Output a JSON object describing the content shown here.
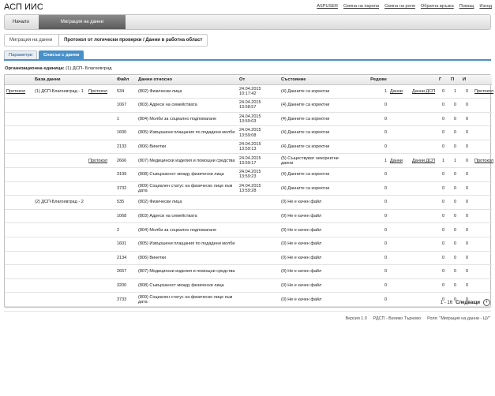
{
  "app": {
    "title": "АСП ИИС"
  },
  "top_links": [
    "ASPUSER",
    "Смяна на парола",
    "Смяна на роля",
    "Обратна връзка",
    "Помощ",
    "Изход"
  ],
  "nav": {
    "tabs": [
      {
        "label": "Начало"
      },
      {
        "label": "Миграция на данни",
        "active": true
      }
    ]
  },
  "breadcrumb": {
    "items": [
      "Миграция на данни",
      "Протокол от логически проверки / Данни в работна област"
    ]
  },
  "sub_tabs": [
    {
      "label": "Параметри"
    },
    {
      "label": "Списък с данни",
      "active": true
    }
  ],
  "org": {
    "label": "Организационна единица:",
    "value": "(1) ДСП- Благоевград"
  },
  "table": {
    "headers": [
      "",
      "База данни",
      "",
      "Файл",
      "Данни относно",
      "От",
      "Състояние",
      "Редове",
      "",
      "",
      "Г",
      "П",
      "И",
      ""
    ],
    "rows": [
      {
        "l1": "Протокол",
        "db": "(1) ДСП-Благоевград - 1",
        "l2": "Протокол",
        "file": "534",
        "subject": "(802) Физически лица",
        "from": "24.04.2015 10:17:42",
        "state": "(4) Данните са коректни",
        "rows": "1",
        "d1": "Данни",
        "d2": "Данни ДСП",
        "g": "0",
        "p": "1",
        "i": "0",
        "l3": "Протокол"
      },
      {
        "l1": "",
        "db": "",
        "l2": "",
        "file": "1067",
        "subject": "(803) Адреси на семействата",
        "from": "24.04.2015 13:58:57",
        "state": "(4) Данните са коректни",
        "rows": "0",
        "d1": "",
        "d2": "",
        "g": "0",
        "p": "0",
        "i": "0",
        "l3": ""
      },
      {
        "l1": "",
        "db": "",
        "l2": "",
        "file": "1",
        "subject": "(804) Молби за социално подпомагане",
        "from": "24.04.2015 13:59:03",
        "state": "(4) Данните са коректни",
        "rows": "0",
        "d1": "",
        "d2": "",
        "g": "0",
        "p": "0",
        "i": "0",
        "l3": ""
      },
      {
        "l1": "",
        "db": "",
        "l2": "",
        "file": "1600",
        "subject": "(805) Извършени плащания по подадени молби",
        "from": "24.04.2015 13:59:08",
        "state": "(4) Данните са коректни",
        "rows": "0",
        "d1": "",
        "d2": "",
        "g": "0",
        "p": "0",
        "i": "0",
        "l3": ""
      },
      {
        "l1": "",
        "db": "",
        "l2": "",
        "file": "2133",
        "subject": "(806) Винетки",
        "from": "24.04.2015 13:59:13",
        "state": "(4) Данните са коректни",
        "rows": "0",
        "d1": "",
        "d2": "",
        "g": "0",
        "p": "0",
        "i": "0",
        "l3": ""
      },
      {
        "l1": "",
        "db": "",
        "l2": "Протокол",
        "file": "2666",
        "subject": "(807) Медицински изделия и помощни средства",
        "from": "24.04.2015 13:59:17",
        "state": "(5) Съществуват некоректни данни",
        "rows": "1",
        "d1": "Данни",
        "d2": "Данни ДСП",
        "g": "1",
        "p": "1",
        "i": "0",
        "l3": "Протокол"
      },
      {
        "l1": "",
        "db": "",
        "l2": "",
        "file": "3199",
        "subject": "(808) Съвързаност между физически лица",
        "from": "24.04.2015 13:59:23",
        "state": "(4) Данните са коректни",
        "rows": "0",
        "d1": "",
        "d2": "",
        "g": "0",
        "p": "0",
        "i": "0",
        "l3": ""
      },
      {
        "l1": "",
        "db": "",
        "l2": "",
        "file": "3732",
        "subject": "(809) Социален статус на физическо лице към дата",
        "from": "24.04.2015 13:59:28",
        "state": "(4) Данните са коректни",
        "rows": "0",
        "d1": "",
        "d2": "",
        "g": "0",
        "p": "0",
        "i": "0",
        "l3": ""
      },
      {
        "l1": "",
        "db": "(2) ДСП-Благоевград - 2",
        "l2": "",
        "file": "535",
        "subject": "(802) Физически лица",
        "from": "",
        "state": "(0) Не е качен файл",
        "rows": "0",
        "d1": "",
        "d2": "",
        "g": "0",
        "p": "0",
        "i": "0",
        "l3": ""
      },
      {
        "l1": "",
        "db": "",
        "l2": "",
        "file": "1068",
        "subject": "(803) Адреси на семействата",
        "from": "",
        "state": "(0) Не е качен файл",
        "rows": "0",
        "d1": "",
        "d2": "",
        "g": "0",
        "p": "0",
        "i": "0",
        "l3": ""
      },
      {
        "l1": "",
        "db": "",
        "l2": "",
        "file": "2",
        "subject": "(804) Молби за социално подпомагане",
        "from": "",
        "state": "(0) Не е качен файл",
        "rows": "0",
        "d1": "",
        "d2": "",
        "g": "0",
        "p": "0",
        "i": "0",
        "l3": ""
      },
      {
        "l1": "",
        "db": "",
        "l2": "",
        "file": "1601",
        "subject": "(805) Извършени плащания по подадени молби",
        "from": "",
        "state": "(0) Не е качен файл",
        "rows": "0",
        "d1": "",
        "d2": "",
        "g": "0",
        "p": "0",
        "i": "0",
        "l3": ""
      },
      {
        "l1": "",
        "db": "",
        "l2": "",
        "file": "2134",
        "subject": "(806) Винетки",
        "from": "",
        "state": "(0) Не е качен файл",
        "rows": "0",
        "d1": "",
        "d2": "",
        "g": "0",
        "p": "0",
        "i": "0",
        "l3": ""
      },
      {
        "l1": "",
        "db": "",
        "l2": "",
        "file": "2667",
        "subject": "(807) Медицински изделия и помощни средства",
        "from": "",
        "state": "(0) Не е качен файл",
        "rows": "0",
        "d1": "",
        "d2": "",
        "g": "0",
        "p": "0",
        "i": "0",
        "l3": ""
      },
      {
        "l1": "",
        "db": "",
        "l2": "",
        "file": "3200",
        "subject": "(808) Съвързаност между физически лица",
        "from": "",
        "state": "(0) Не е качен файл",
        "rows": "0",
        "d1": "",
        "d2": "",
        "g": "0",
        "p": "0",
        "i": "0",
        "l3": ""
      },
      {
        "l1": "",
        "db": "",
        "l2": "",
        "file": "3733",
        "subject": "(809) Социален статус на физическо лице към дата",
        "from": "",
        "state": "(0) Не е качен файл",
        "rows": "0",
        "d1": "",
        "d2": "",
        "g": "0",
        "p": "0",
        "i": "0",
        "l3": ""
      }
    ]
  },
  "pager": {
    "range": "1 - 16",
    "next_label": "Следващи",
    "next_icon": "chevron-right-icon"
  },
  "footer": {
    "version": "Версия 1.0",
    "unit": "РДСП - Велико Търново",
    "role": "Роля: \"Миграция на данни - ЦУ\""
  }
}
